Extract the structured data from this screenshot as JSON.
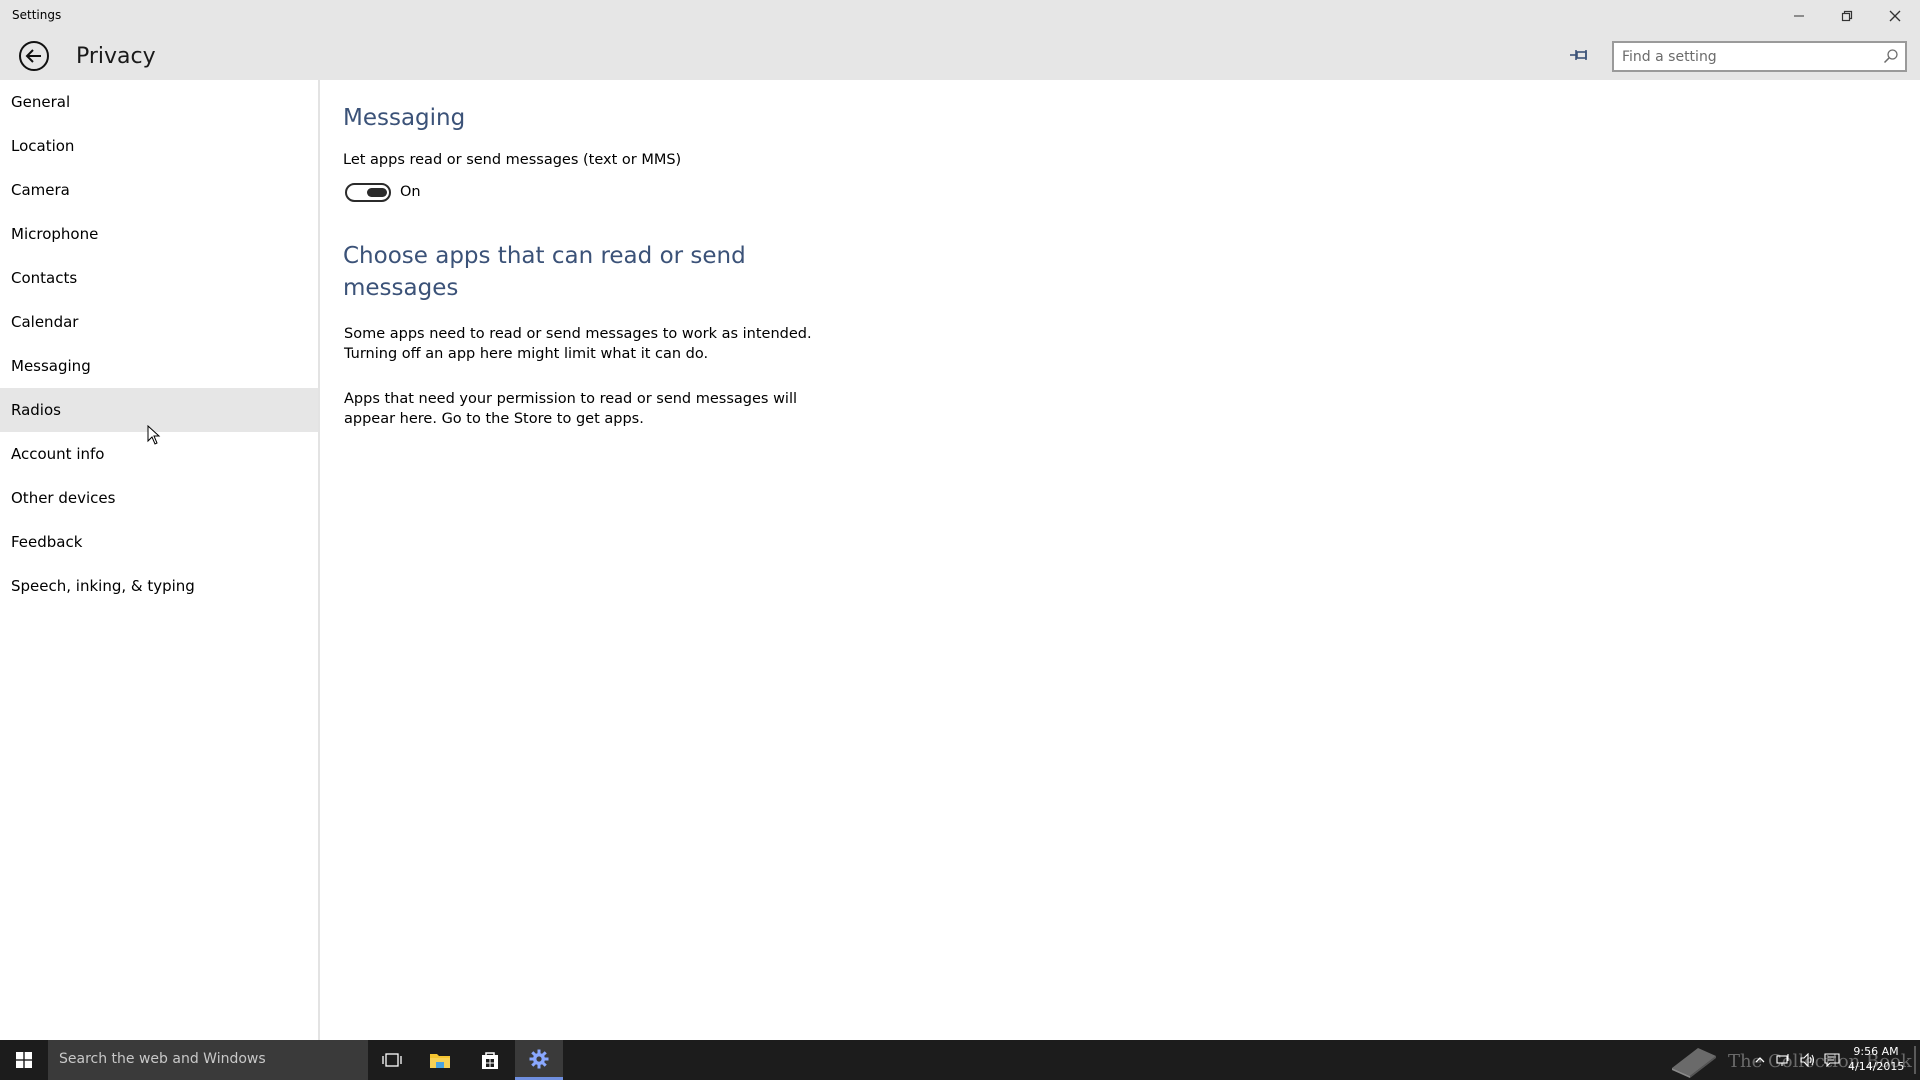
{
  "window": {
    "title": "Settings"
  },
  "header": {
    "page_title": "Privacy",
    "search_placeholder": "Find a setting"
  },
  "sidebar": {
    "items": [
      {
        "label": "General"
      },
      {
        "label": "Location"
      },
      {
        "label": "Camera"
      },
      {
        "label": "Microphone"
      },
      {
        "label": "Contacts"
      },
      {
        "label": "Calendar"
      },
      {
        "label": "Messaging"
      },
      {
        "label": "Radios"
      },
      {
        "label": "Account info"
      },
      {
        "label": "Other devices"
      },
      {
        "label": "Feedback"
      },
      {
        "label": "Speech, inking, & typing"
      }
    ],
    "hovered_item": "Radios"
  },
  "main": {
    "section_title": "Messaging",
    "toggle_label": "Let apps read or send messages (text or MMS)",
    "toggle_state": "On",
    "choose_title_line1": "Choose apps that can read or send",
    "choose_title_line2": "messages",
    "paragraph1_line1": "Some apps need to read or send messages to work as intended.",
    "paragraph1_line2": "Turning off an app here might limit what it can do.",
    "paragraph2_line1": "Apps that need your permission to read or send messages will",
    "paragraph2_line2": "appear here. Go to the Store to get apps."
  },
  "taskbar": {
    "search_text": "Search the web and Windows",
    "watermark_text": "The Collection Book",
    "time": "9:56 AM",
    "date": "4/14/2015"
  },
  "colors": {
    "header_bg": "#e6e6e6",
    "section_title": "#3b5278",
    "taskbar_bg": "#1c1c1c",
    "active_task_accent": "#6f8fe0"
  }
}
